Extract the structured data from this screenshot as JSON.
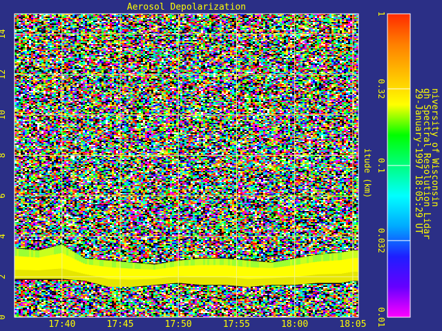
{
  "chart_data": {
    "type": "heatmap",
    "title": "Aerosol Depolarization",
    "ylabel": "itude (km)",
    "x_ticks": [
      "17:40",
      "17:45",
      "17:50",
      "17:55",
      "18:00",
      "18:05"
    ],
    "y_ticks": [
      "0",
      "2",
      "4",
      "6",
      "8",
      "10",
      "12",
      "14"
    ],
    "xlim": [
      "17:35:55",
      "18:05:29"
    ],
    "ylim": [
      0,
      15
    ],
    "grid": true,
    "colorbar": {
      "scale": "log",
      "range": [
        0.01,
        1
      ],
      "tick_labels": [
        "1",
        "0.32",
        "0.1",
        "0.032",
        "0.01"
      ],
      "tick_values": [
        1,
        0.32,
        0.1,
        0.032,
        0.01
      ]
    },
    "feature": {
      "name": "aerosol layer",
      "description_from_plot": "depolarization ~0.3 from surface up to boundary layer top; noisy above",
      "layer_top_km_by_time": [
        [
          "17:36",
          3.4
        ],
        [
          "17:38",
          3.3
        ],
        [
          "17:40",
          3.6
        ],
        [
          "17:42",
          2.9
        ],
        [
          "17:44",
          2.8
        ],
        [
          "17:46",
          2.7
        ],
        [
          "17:48",
          2.6
        ],
        [
          "17:50",
          2.8
        ],
        [
          "17:52",
          2.9
        ],
        [
          "17:54",
          2.9
        ],
        [
          "17:56",
          2.8
        ],
        [
          "17:58",
          2.7
        ],
        [
          "18:00",
          2.9
        ],
        [
          "18:02",
          3.1
        ],
        [
          "18:04",
          3.2
        ],
        [
          "18:05",
          3.3
        ]
      ],
      "layer_bottom_km_by_time": [
        [
          "17:36",
          1.9
        ],
        [
          "17:38",
          1.9
        ],
        [
          "17:40",
          1.9
        ],
        [
          "17:42",
          1.8
        ],
        [
          "17:44",
          1.5
        ],
        [
          "17:46",
          1.5
        ],
        [
          "17:48",
          1.6
        ],
        [
          "17:50",
          1.7
        ],
        [
          "17:52",
          1.6
        ],
        [
          "17:54",
          1.6
        ],
        [
          "17:56",
          1.5
        ],
        [
          "17:58",
          1.6
        ],
        [
          "18:00",
          1.6
        ],
        [
          "18:02",
          1.7
        ],
        [
          "18:04",
          1.7
        ],
        [
          "18:05",
          1.8
        ]
      ]
    }
  },
  "side_text": {
    "line1": "niversity of Wisconsin",
    "line2": "gh Spectral Resolution Lidar",
    "line3": "29-January-1997 18:05:29 UT"
  },
  "colors": {
    "background": "#2b2f86",
    "text": "#ffff00",
    "grid": "#f2f28a",
    "frame": "#ffffff",
    "colorbar_stops": [
      "#ff00ff",
      "#6600ff",
      "#1e1eff",
      "#00aaff",
      "#00ffff",
      "#00ff7f",
      "#00ff00",
      "#ffff00",
      "#ffbf00",
      "#ff7f00",
      "#ff2a00"
    ]
  }
}
